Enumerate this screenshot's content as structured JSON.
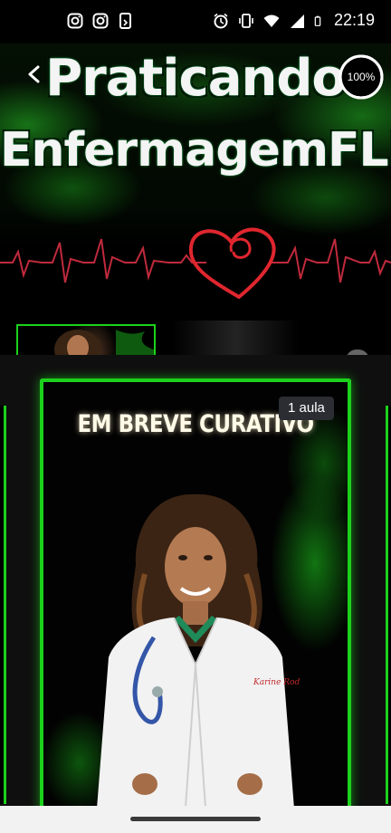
{
  "status_bar": {
    "left_icons": [
      "instagram-icon",
      "instagram-icon",
      "phone-notification-icon"
    ],
    "right_icons": [
      "alarm-icon",
      "vibrate-icon",
      "wifi-icon",
      "signal-icon",
      "battery-icon"
    ],
    "time": "22:19"
  },
  "banner": {
    "title_line1": "Praticando",
    "title_line2": "EnfermagemFLIX",
    "progress": "100%",
    "progress_fraction": 1.0,
    "accent_color": "#1cd11c"
  },
  "course_card": {
    "title": "EM BREVE CURATIVO",
    "lesson_count": "1 aula",
    "coat_label": "Karine Rodrigues"
  }
}
